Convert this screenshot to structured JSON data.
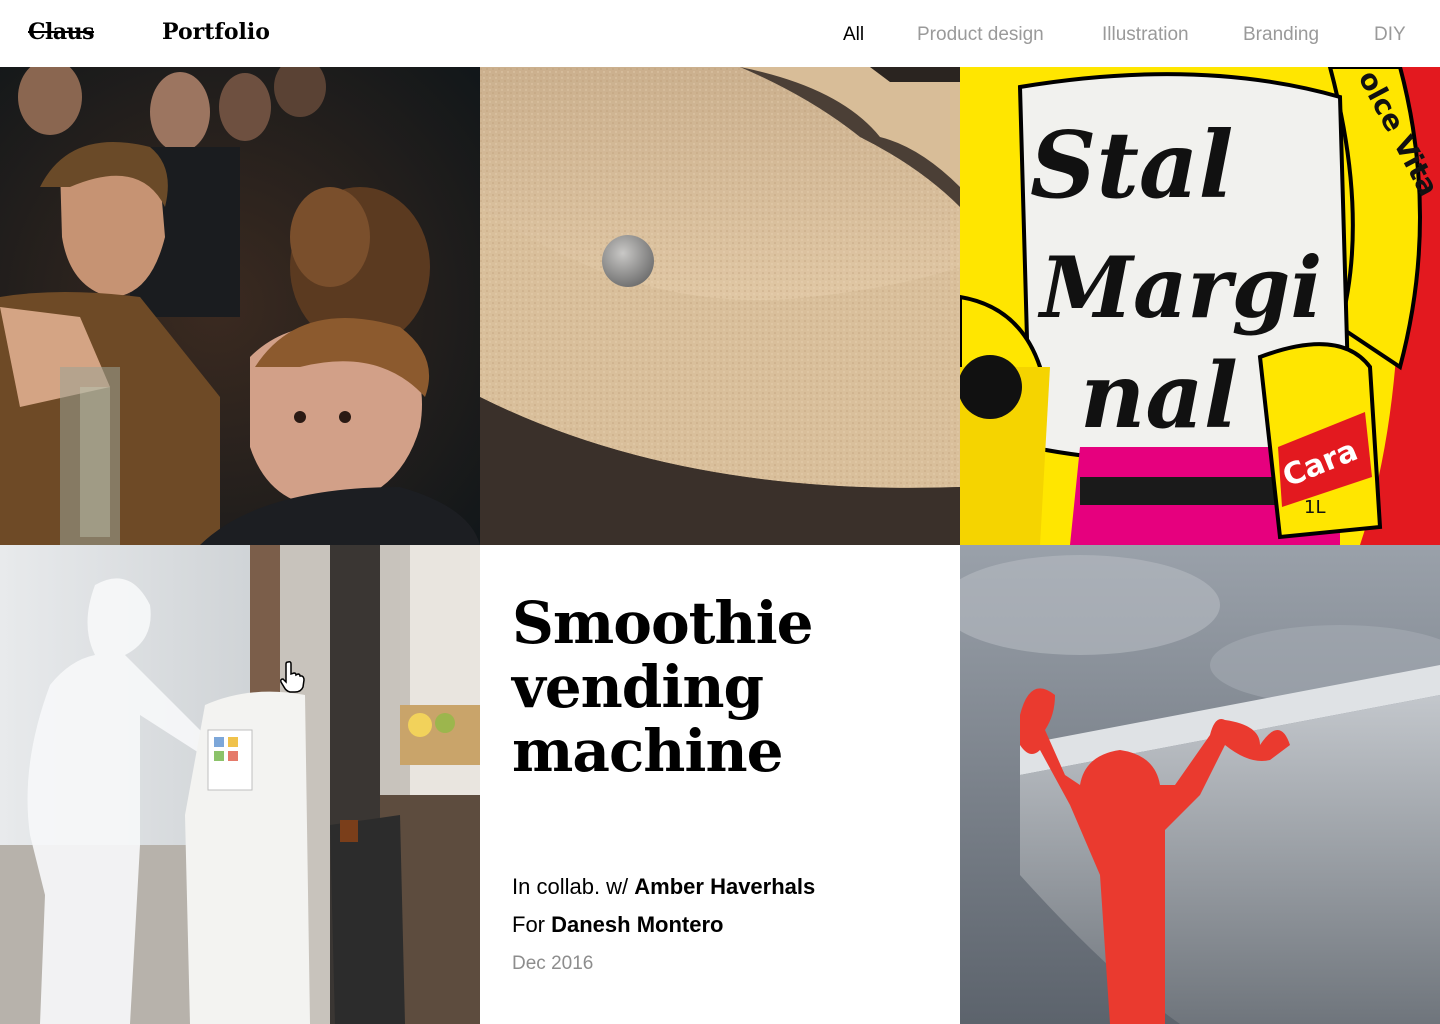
{
  "header": {
    "brand_struck": "Claus",
    "brand": "Portfolio",
    "nav": [
      "All",
      "Product design",
      "Illustration",
      "Branding",
      "DIY"
    ],
    "active_nav": "All"
  },
  "tiles": {
    "party_photo": "party-photo",
    "cork_bowl": "cork-bowl-with-marble",
    "poster": {
      "word1": "Stal",
      "word2": "Margi",
      "word3": "nal",
      "side_text": "olce Vita",
      "can_label": "Cara",
      "can_size": "1L"
    },
    "vending_photo": "vending-machine-render",
    "red_figure": "red-figure-hook"
  },
  "project": {
    "title": "Smoothie vending machine",
    "collab_prefix": "In collab. w/ ",
    "collab_name": "Amber Haverhals",
    "for_prefix": "For ",
    "for_name": "Danesh Montero",
    "date": "Dec 2016"
  }
}
